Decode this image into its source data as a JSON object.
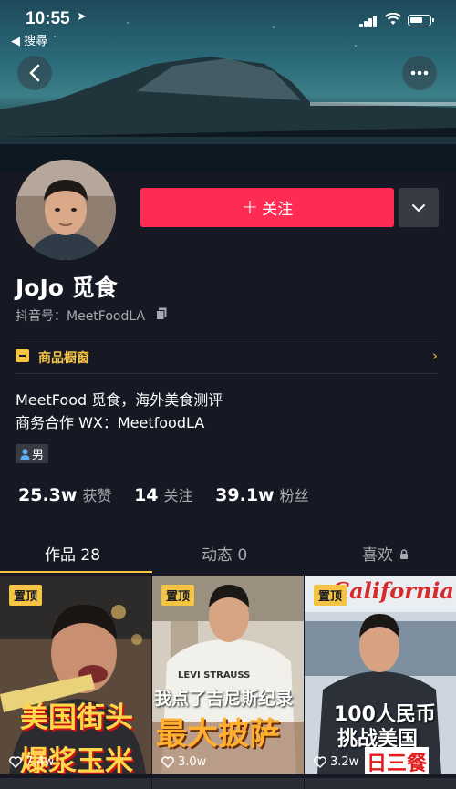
{
  "status_bar": {
    "time": "10:55",
    "back_app": "◀ 搜尋"
  },
  "profile": {
    "name": "JoJo 觅食",
    "douyin_id": "抖音号：MeetFoodLA",
    "follow_label": "关注",
    "shop_window_label": "商品橱窗",
    "bio_lines": [
      "MeetFood 觅食，海外美食测评",
      "商务合作 WX：MeetfoodLA"
    ],
    "gender": "男"
  },
  "stats": [
    {
      "value": "25.3w",
      "label": "获赞"
    },
    {
      "value": "14",
      "label": "关注"
    },
    {
      "value": "39.1w",
      "label": "粉丝"
    }
  ],
  "tabs": [
    {
      "label": "作品 28",
      "active": true
    },
    {
      "label": "动态 0",
      "active": false
    },
    {
      "label": "喜欢",
      "active": false,
      "locked": true
    }
  ],
  "videos": [
    {
      "pinned_label": "置顶",
      "likes": "7.4w",
      "caption_top": "美国街头",
      "caption_bottom": "爆浆玉米"
    },
    {
      "pinned_label": "置顶",
      "likes": "3.0w",
      "caption_top": "我点了吉尼斯纪录",
      "caption_bottom": "最大披萨",
      "shirt_text": "LEVI STRAUSS"
    },
    {
      "pinned_label": "置顶",
      "likes": "3.2w",
      "caption_top": "100人民币",
      "caption_bottom": "挑战美国",
      "caption_extra": "日三餐",
      "sign_text": "California"
    }
  ],
  "colors": {
    "accent": "#fe2c55",
    "gold": "#f6c443",
    "background": "#161823"
  }
}
